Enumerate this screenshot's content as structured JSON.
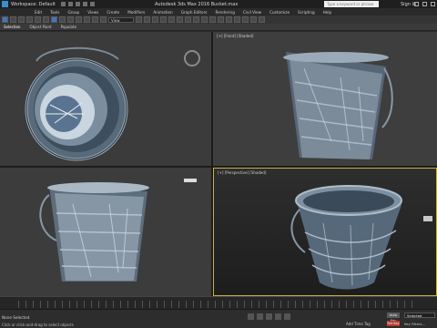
{
  "titlebar": {
    "workspace": "Workspace: Default",
    "title": "Autodesk 3ds Max 2016    Bucket.max",
    "search_placeholder": "Type a keyword or phrase",
    "signin": "Sign In"
  },
  "menu": [
    "Edit",
    "Tools",
    "Group",
    "Views",
    "Create",
    "Modifiers",
    "Animation",
    "Graph Editors",
    "Rendering",
    "Civil View",
    "Customize",
    "Scripting",
    "Help"
  ],
  "toolbar": {
    "view_select": "View"
  },
  "ribbon": {
    "tabs": [
      "Selection",
      "Object Paint",
      "Populate"
    ]
  },
  "viewports": {
    "top_right_label": "[+] [Front] [Shaded]",
    "bottom_right_label": "[+] [Perspective] [Shaded]"
  },
  "status": {
    "selection": "None Selected",
    "hint": "Click or click-and-drag to select objects",
    "selected_field": "Selected",
    "auto_key": "Auto Key",
    "set_key": "Set Key",
    "key_filters": "Key Filters...",
    "add_time_tag": "Add Time Tag"
  }
}
